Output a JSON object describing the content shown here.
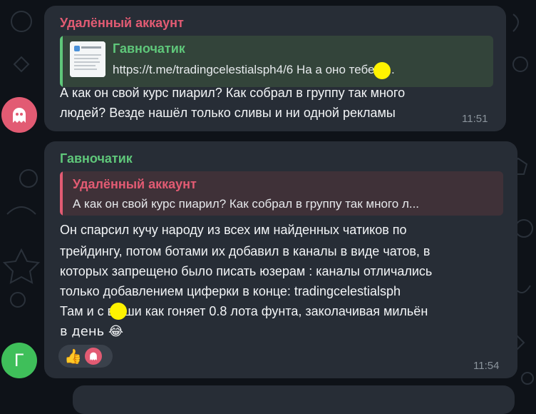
{
  "colors": {
    "background": "#0e1218",
    "bubble": "#272d36",
    "deleted_account": "#e25b73",
    "gavno_name": "#5fc77a",
    "time": "#8b949c",
    "redaction": "#fff200"
  },
  "messages": [
    {
      "sender": "Удалённый аккаунт",
      "reply": {
        "title": "Гавночатик",
        "text": "https://t.me/tradingcelestialsph4/6  На   а оно тебе н..."
      },
      "lines": [
        "А как он свой курс пиарил? Как собрал в группу так много",
        "людей? Везде нашёл только сливы и ни одной рекламы"
      ],
      "time": "11:51",
      "avatar_icon": "ghost-icon"
    },
    {
      "sender": "Гавночатик",
      "reply": {
        "title": "Удалённый аккаунт",
        "text": "А как он свой курс пиарил? Как собрал в группу так много л..."
      },
      "lines": [
        "Он спарсил кучу народу из всех им найденных чатиков по",
        "трейдингу, потом ботами их добавил в каналы в виде чатов, в",
        "которых запрещено было писать юзерам : каналы отличались",
        "только добавлением циферки в конце: tradingcelestialsph",
        "Там и с     в уши как гоняет 0.8 лота фунта, заколачивая мильён",
        "в день 😂"
      ],
      "time": "11:54",
      "avatar_letter": "Г",
      "reactions": [
        "thumbs-up-icon",
        "ghost-icon"
      ]
    }
  ]
}
